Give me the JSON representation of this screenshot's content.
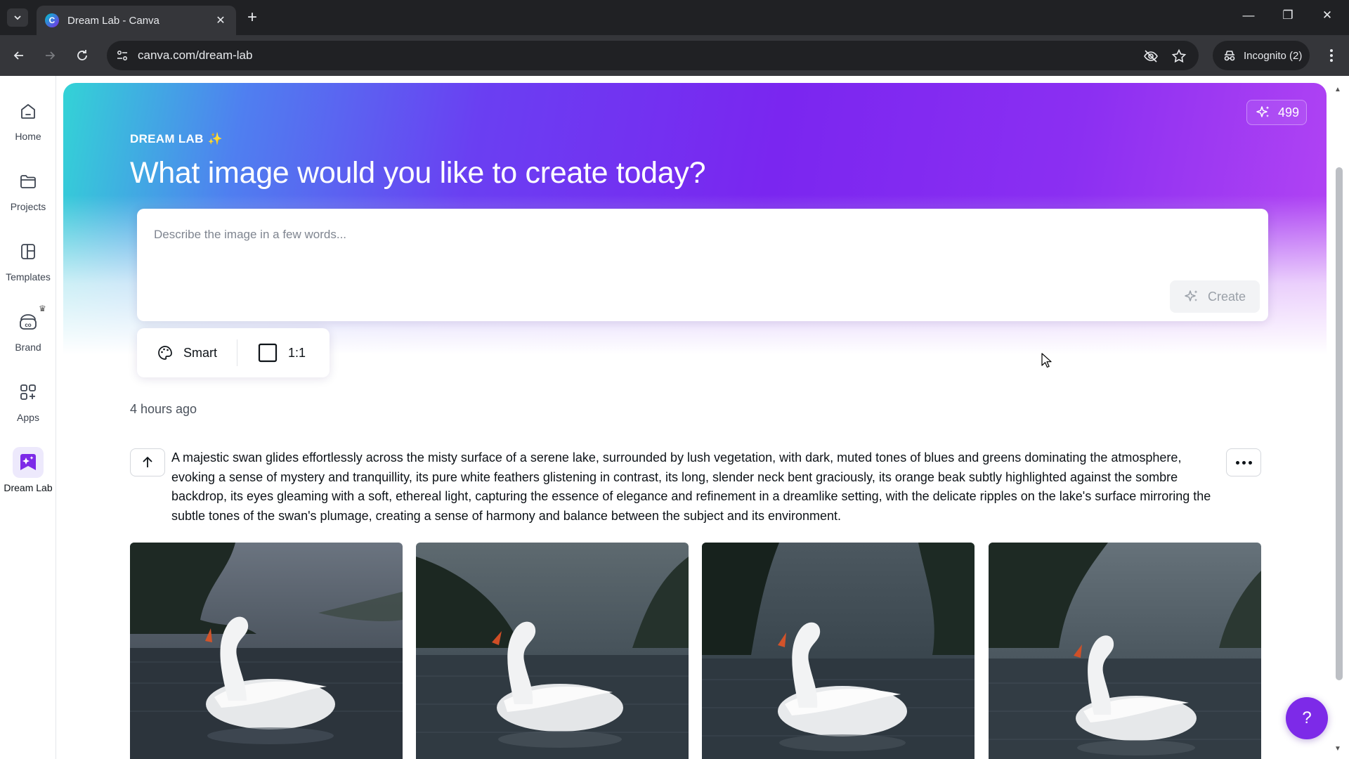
{
  "browser": {
    "tab_title": "Dream Lab - Canva",
    "favicon_letter": "C",
    "url": "canva.com/dream-lab",
    "incognito_label": "Incognito (2)"
  },
  "sidebar": {
    "items": [
      {
        "label": "Home",
        "icon": "home-icon"
      },
      {
        "label": "Projects",
        "icon": "folder-icon"
      },
      {
        "label": "Templates",
        "icon": "templates-icon"
      },
      {
        "label": "Brand",
        "icon": "brand-icon"
      },
      {
        "label": "Apps",
        "icon": "apps-icon"
      },
      {
        "label": "Dream Lab",
        "icon": "dream-lab-icon",
        "active": true
      }
    ]
  },
  "hero": {
    "eyebrow": "DREAM LAB",
    "eyebrow_glyph": "✨",
    "headline": "What image would you like to create today?",
    "credits": "499"
  },
  "prompt": {
    "placeholder": "Describe the image in a few words...",
    "value": "",
    "create_label": "Create"
  },
  "options": {
    "style_label": "Smart",
    "ratio_label": "1:1"
  },
  "history": {
    "timestamp": "4 hours ago",
    "prompt_text": "A majestic swan glides effortlessly across the misty surface of a serene lake, surrounded by lush vegetation, with dark, muted tones of blues and greens dominating the atmosphere, evoking a sense of mystery and tranquillity, its pure white feathers glistening in contrast, its long, slender neck bent graciously, its orange beak subtly highlighted against the sombre backdrop, its eyes gleaming with a soft, ethereal light, capturing the essence of elegance and refinement in a dreamlike setting, with the delicate ripples on the lake's surface mirroring the subtle tones of the swan's plumage, creating a sense of harmony and balance between the subject and its environment."
  },
  "help_label": "?",
  "colors": {
    "accent": "#7d2ae8",
    "hero_start": "#33d3d6",
    "hero_mid": "#7a26f0",
    "hero_end": "#b445f3"
  }
}
